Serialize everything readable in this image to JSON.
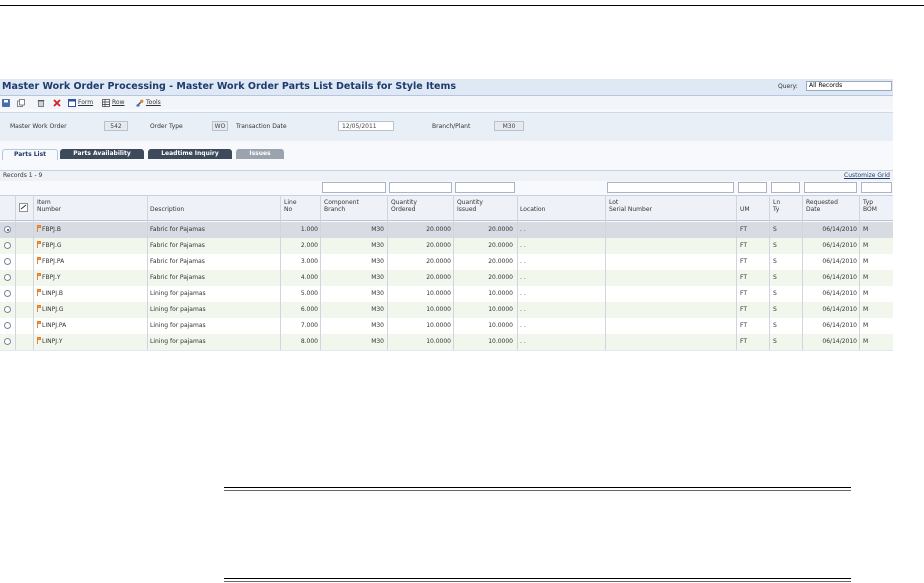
{
  "window": {
    "title": "Master Work Order Processing - Master Work Order Parts List Details for Style Items",
    "query_label": "Query:",
    "query_value": "All Records"
  },
  "toolbar": {
    "form_label": "Form",
    "row_label": "Row",
    "tools_label": "Tools"
  },
  "header": {
    "master_work_order_label": "Master Work Order",
    "master_work_order_value": "542",
    "order_type_label": "Order Type",
    "order_type_value": "WO",
    "transaction_date_label": "Transaction Date",
    "transaction_date_value": "12/05/2011",
    "branch_plant_label": "Branch/Plant",
    "branch_plant_value": "M30"
  },
  "tabs": [
    {
      "label": "Parts List"
    },
    {
      "label": "Parts Availability"
    },
    {
      "label": "Leadtime Inquiry"
    },
    {
      "label": "Issues"
    }
  ],
  "grid": {
    "records_label": "Records 1 - 9",
    "customize_label": "Customize Grid",
    "columns": [
      {
        "l1": "Item",
        "l2": "Number"
      },
      {
        "l1": "",
        "l2": "Description"
      },
      {
        "l1": "Line",
        "l2": "No"
      },
      {
        "l1": "Component",
        "l2": "Branch"
      },
      {
        "l1": "Quantity",
        "l2": "Ordered"
      },
      {
        "l1": "Quantity",
        "l2": "Issued"
      },
      {
        "l1": "",
        "l2": "Location"
      },
      {
        "l1": "Lot",
        "l2": "Serial Number"
      },
      {
        "l1": "",
        "l2": "UM"
      },
      {
        "l1": "Ln",
        "l2": "Ty"
      },
      {
        "l1": "Requested",
        "l2": "Date"
      },
      {
        "l1": "Typ",
        "l2": "BOM"
      }
    ],
    "rows": [
      {
        "item": "FBPJ.B",
        "desc": "Fabric for Pajamas",
        "line": "1.000",
        "branch": "M30",
        "ordered": "20.0000",
        "issued": "20.0000",
        "loc": ". .",
        "lot": "",
        "um": "FT",
        "ty": "S",
        "date": "06/14/2010",
        "bom": "M"
      },
      {
        "item": "FBPJ.G",
        "desc": "Fabric for Pajamas",
        "line": "2.000",
        "branch": "M30",
        "ordered": "20.0000",
        "issued": "20.0000",
        "loc": ". .",
        "lot": "",
        "um": "FT",
        "ty": "S",
        "date": "06/14/2010",
        "bom": "M"
      },
      {
        "item": "FBPJ.PA",
        "desc": "Fabric for Pajamas",
        "line": "3.000",
        "branch": "M30",
        "ordered": "20.0000",
        "issued": "20.0000",
        "loc": ". .",
        "lot": "",
        "um": "FT",
        "ty": "S",
        "date": "06/14/2010",
        "bom": "M"
      },
      {
        "item": "FBPJ.Y",
        "desc": "Fabric for Pajamas",
        "line": "4.000",
        "branch": "M30",
        "ordered": "20.0000",
        "issued": "20.0000",
        "loc": ". .",
        "lot": "",
        "um": "FT",
        "ty": "S",
        "date": "06/14/2010",
        "bom": "M"
      },
      {
        "item": "LINPJ.B",
        "desc": "Lining for pajamas",
        "line": "5.000",
        "branch": "M30",
        "ordered": "10.0000",
        "issued": "10.0000",
        "loc": ". .",
        "lot": "",
        "um": "FT",
        "ty": "S",
        "date": "06/14/2010",
        "bom": "M"
      },
      {
        "item": "LINPJ.G",
        "desc": "Lining for pajamas",
        "line": "6.000",
        "branch": "M30",
        "ordered": "10.0000",
        "issued": "10.0000",
        "loc": ". .",
        "lot": "",
        "um": "FT",
        "ty": "S",
        "date": "06/14/2010",
        "bom": "M"
      },
      {
        "item": "LINPJ.PA",
        "desc": "Lining for pajamas",
        "line": "7.000",
        "branch": "M30",
        "ordered": "10.0000",
        "issued": "10.0000",
        "loc": ". .",
        "lot": "",
        "um": "FT",
        "ty": "S",
        "date": "06/14/2010",
        "bom": "M"
      },
      {
        "item": "LINPJ.Y",
        "desc": "Lining for pajamas",
        "line": "8.000",
        "branch": "M30",
        "ordered": "10.0000",
        "issued": "10.0000",
        "loc": ". .",
        "lot": "",
        "um": "FT",
        "ty": "S",
        "date": "06/14/2010",
        "bom": "M"
      }
    ]
  },
  "colors": {
    "title_bar": "#dfe8f5",
    "title_text": "#1f3b6b",
    "selected_row": "#d8dbe1",
    "alt_row": "#f2f7ed"
  },
  "icons": [
    "save-icon",
    "copy-icon",
    "delete-icon",
    "close-icon",
    "form-icon",
    "row-icon",
    "tools-icon",
    "item-flag-icon"
  ]
}
